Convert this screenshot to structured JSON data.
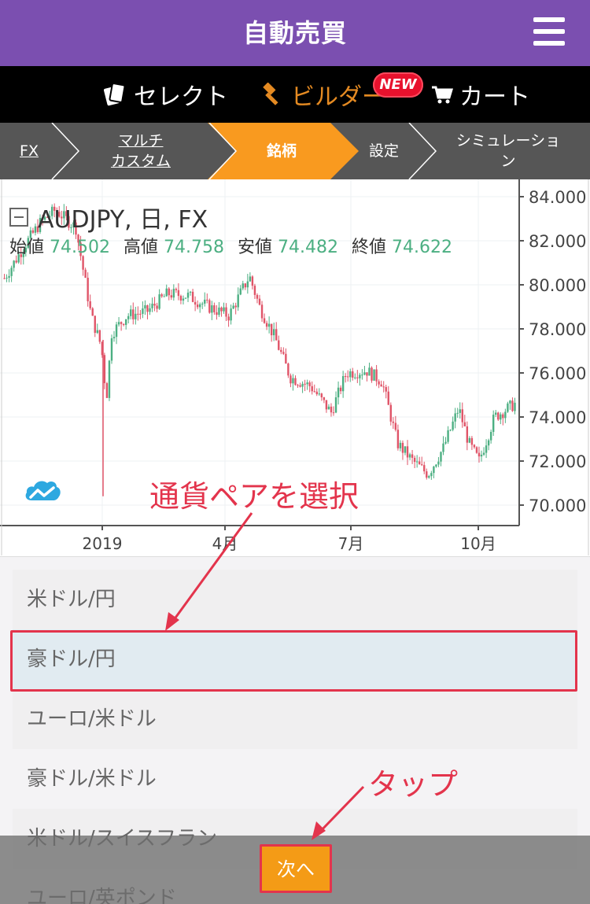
{
  "header": {
    "title": "自動売買"
  },
  "nav": {
    "select_label": "セレクト",
    "builder_label": "ビルダー",
    "new_badge": "NEW",
    "cart_label": "カート"
  },
  "steps": [
    {
      "label": "FX"
    },
    {
      "label": "マルチ\nカスタム"
    },
    {
      "label": "銘柄"
    },
    {
      "label": "設定"
    },
    {
      "label": "シミュレーショ\nン"
    }
  ],
  "chart": {
    "symbol_title": "AUDJPY, 日, FX",
    "ohlc": [
      {
        "label": "始値",
        "value": "74.502"
      },
      {
        "label": "高値",
        "value": "74.758"
      },
      {
        "label": "安値",
        "value": "74.482"
      },
      {
        "label": "終値",
        "value": "74.622"
      }
    ]
  },
  "chart_data": {
    "type": "candlestick",
    "x_tick_labels": [
      "2019",
      "4月",
      "7月",
      "10月"
    ],
    "y_tick_labels": [
      "84.000",
      "82.000",
      "80.000",
      "78.000",
      "76.000",
      "74.000",
      "72.000",
      "70.000"
    ],
    "ylim": [
      70,
      84
    ],
    "grid": true,
    "up_color": "#4caf82",
    "down_color": "#e05468",
    "trend": [
      [
        0,
        80.3
      ],
      [
        0.04,
        81.8
      ],
      [
        0.07,
        82.8
      ],
      [
        0.1,
        83.4
      ],
      [
        0.14,
        82.6
      ],
      [
        0.17,
        78.6
      ],
      [
        0.19,
        77.2
      ],
      [
        0.2,
        74.8
      ],
      [
        0.21,
        77.8
      ],
      [
        0.24,
        78.6
      ],
      [
        0.28,
        78.8
      ],
      [
        0.32,
        79.6
      ],
      [
        0.36,
        79.5
      ],
      [
        0.4,
        79.0
      ],
      [
        0.44,
        78.6
      ],
      [
        0.48,
        80.4
      ],
      [
        0.5,
        79.0
      ],
      [
        0.53,
        77.6
      ],
      [
        0.56,
        75.8
      ],
      [
        0.6,
        75.4
      ],
      [
        0.64,
        74.2
      ],
      [
        0.67,
        76.0
      ],
      [
        0.71,
        76.1
      ],
      [
        0.74,
        75.6
      ],
      [
        0.77,
        72.8
      ],
      [
        0.8,
        72.0
      ],
      [
        0.83,
        71.4
      ],
      [
        0.86,
        72.6
      ],
      [
        0.89,
        74.4
      ],
      [
        0.91,
        72.8
      ],
      [
        0.93,
        72.0
      ],
      [
        0.96,
        74.0
      ],
      [
        1.0,
        74.6
      ]
    ]
  },
  "list": {
    "items": [
      "米ドル/円",
      "豪ドル/円",
      "ユーロ/米ドル",
      "豪ドル/米ドル",
      "米ドル/スイスフラン",
      "ユーロ/英ポンド"
    ],
    "selected_index": 1
  },
  "next_button": {
    "label": "次へ"
  },
  "annotations": {
    "select_pair": "通貨ペアを選択",
    "tap": "タップ"
  },
  "colors": {
    "header": "#7b4fb0",
    "active_step": "#f99a1f",
    "annotation": "#e3344c",
    "up": "#4caf82",
    "down": "#e05468"
  }
}
